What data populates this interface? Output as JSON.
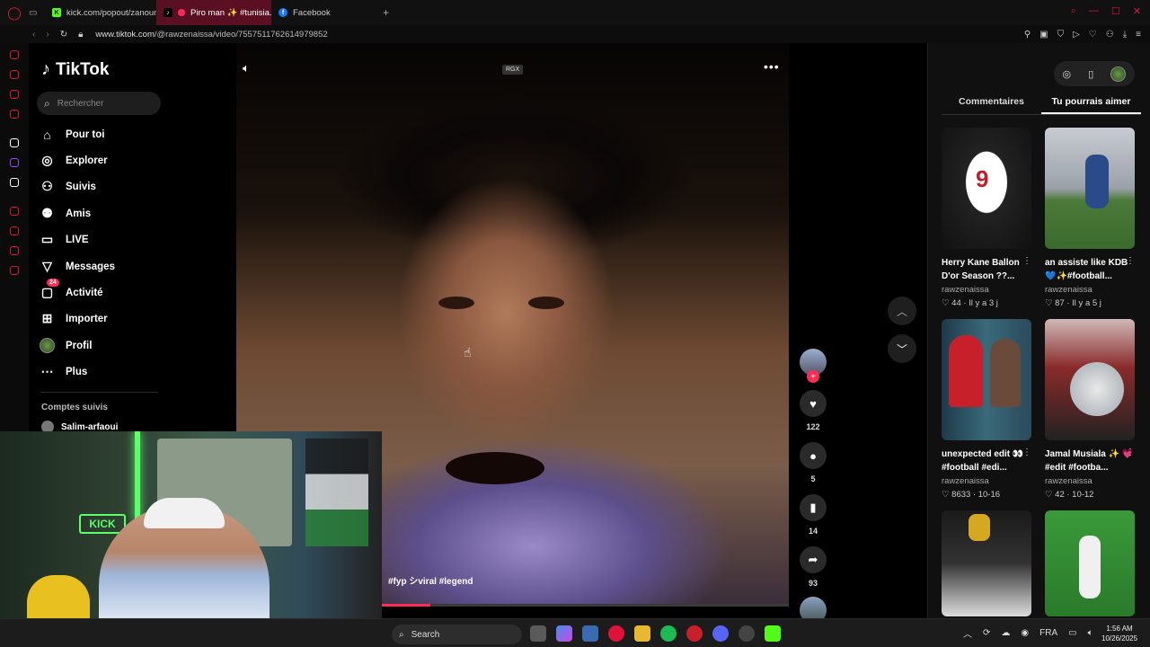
{
  "browser": {
    "tabs": [
      {
        "label": "kick.com/popout/zanoun..."
      },
      {
        "label": "Piro man ✨ #tunisia..."
      },
      {
        "label": "Facebook"
      }
    ],
    "url_host": "www.tiktok.com",
    "url_path": "/@rawzenaissa/video/7557511762614979852"
  },
  "tiktok": {
    "logo": "TikTok",
    "search_placeholder": "Rechercher",
    "nav": [
      {
        "label": "Pour toi",
        "icon": "home-icon"
      },
      {
        "label": "Explorer",
        "icon": "compass-icon"
      },
      {
        "label": "Suivis",
        "icon": "following-icon"
      },
      {
        "label": "Amis",
        "icon": "friends-icon"
      },
      {
        "label": "LIVE",
        "icon": "live-icon"
      },
      {
        "label": "Messages",
        "icon": "messages-icon"
      },
      {
        "label": "Activité",
        "icon": "activity-icon",
        "badge": "24"
      },
      {
        "label": "Importer",
        "icon": "upload-icon"
      },
      {
        "label": "Profil",
        "icon": "profile-icon"
      },
      {
        "label": "Plus",
        "icon": "more-icon"
      }
    ],
    "followed_title": "Comptes suivis",
    "followed": [
      "Salim-arfaoui"
    ]
  },
  "video": {
    "watermark": "RGX",
    "hashtags": "#fyp シviral #legend",
    "progress": 0.12,
    "likes": "122",
    "comments": "5",
    "saves": "14",
    "shares": "93"
  },
  "right_panel": {
    "tabs": [
      "Commentaires",
      "Tu pourrais aimer"
    ],
    "active_tab": 1,
    "cards": [
      {
        "title": "Herry Kane Ballon D'or Season ??...",
        "user": "rawzenaissa",
        "stats": "♡ 44 · Il y a 3 j"
      },
      {
        "title": "an assiste like KDB 💙✨#football...",
        "user": "rawzenaissa",
        "stats": "♡ 87 · Il y a 5 j"
      },
      {
        "title": "unexpected edit 👀#football #edi...",
        "user": "rawzenaissa",
        "stats": "♡ 8633 · 10-16"
      },
      {
        "title": "Jamal Musiala ✨ 💗#edit #footba...",
        "user": "rawzenaissa",
        "stats": "♡ 42 · 10-12"
      },
      {
        "title": "",
        "user": "",
        "stats": ""
      },
      {
        "title": "",
        "user": "",
        "stats": ""
      }
    ]
  },
  "webcam": {
    "sign": "KICK"
  },
  "taskbar": {
    "search": "Search",
    "lang": "FRA",
    "time": "1:56 AM",
    "date": "10/26/2025"
  },
  "colors": {
    "accent": "#fe2c55",
    "opera": "#e0123a"
  }
}
